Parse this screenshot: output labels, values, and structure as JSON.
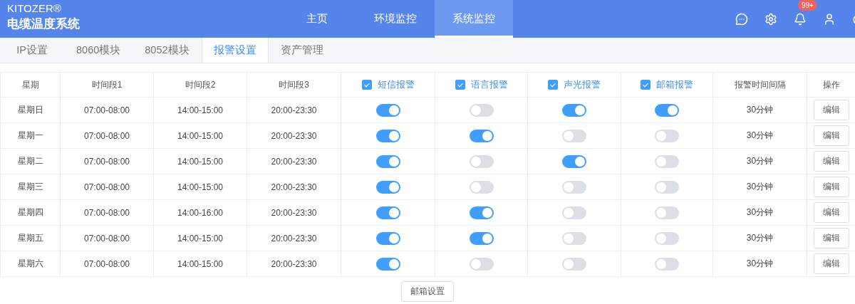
{
  "brand": {
    "name": "KITOZER®",
    "subtitle": "电缆温度系统"
  },
  "nav": [
    {
      "label": "主页",
      "selected": false
    },
    {
      "label": "环境监控",
      "selected": false
    },
    {
      "label": "系统监控",
      "selected": true
    }
  ],
  "notifications": {
    "badge": "99+"
  },
  "tabs": [
    {
      "label": "IP设置",
      "selected": false
    },
    {
      "label": "8060模块",
      "selected": false
    },
    {
      "label": "8052模块",
      "selected": false
    },
    {
      "label": "报警设置",
      "selected": true
    },
    {
      "label": "资产管理",
      "selected": false
    }
  ],
  "table": {
    "columns": [
      {
        "label": "星期",
        "kind": "text"
      },
      {
        "label": "时间段1",
        "kind": "text"
      },
      {
        "label": "时间段2",
        "kind": "text"
      },
      {
        "label": "时间段3",
        "kind": "text"
      },
      {
        "label": "短信报警",
        "kind": "check",
        "checked": true
      },
      {
        "label": "语言报警",
        "kind": "check",
        "checked": true
      },
      {
        "label": "声光报警",
        "kind": "check",
        "checked": true
      },
      {
        "label": "邮箱报警",
        "kind": "check",
        "checked": true
      },
      {
        "label": "报警时间间隔",
        "kind": "text"
      },
      {
        "label": "操作",
        "kind": "text"
      }
    ],
    "rows": [
      {
        "day": "星期日",
        "t1": "07:00-08:00",
        "t2": "14:00-15:00",
        "t3": "20:00-23:30",
        "switches": [
          true,
          false,
          true,
          true
        ],
        "interval": "30分钟",
        "action": "编辑"
      },
      {
        "day": "星期一",
        "t1": "07:00-08:00",
        "t2": "14:00-15:00",
        "t3": "20:00-23:30",
        "switches": [
          true,
          true,
          false,
          false
        ],
        "interval": "30分钟",
        "action": "编辑"
      },
      {
        "day": "星期二",
        "t1": "07:00-08:00",
        "t2": "14:00-15:00",
        "t3": "20:00-23:30",
        "switches": [
          true,
          false,
          true,
          false
        ],
        "interval": "30分钟",
        "action": "编辑"
      },
      {
        "day": "星期三",
        "t1": "07:00-08:00",
        "t2": "14:00-15:00",
        "t3": "20:00-23:30",
        "switches": [
          true,
          false,
          false,
          false
        ],
        "interval": "30分钟",
        "action": "编辑"
      },
      {
        "day": "星期四",
        "t1": "07:00-08:00",
        "t2": "14:00-16:00",
        "t3": "20:00-23:30",
        "switches": [
          true,
          true,
          false,
          false
        ],
        "interval": "30分钟",
        "action": "编辑"
      },
      {
        "day": "星期五",
        "t1": "07:00-08:00",
        "t2": "14:00-15:00",
        "t3": "20:00-23:30",
        "switches": [
          true,
          true,
          false,
          false
        ],
        "interval": "30分钟",
        "action": "编辑"
      },
      {
        "day": "星期六",
        "t1": "07:00-08:00",
        "t2": "14:00-15:00",
        "t3": "20:00-23:30",
        "switches": [
          true,
          false,
          false,
          false
        ],
        "interval": "30分钟",
        "action": "编辑"
      }
    ]
  },
  "footer_button": "邮箱设置"
}
